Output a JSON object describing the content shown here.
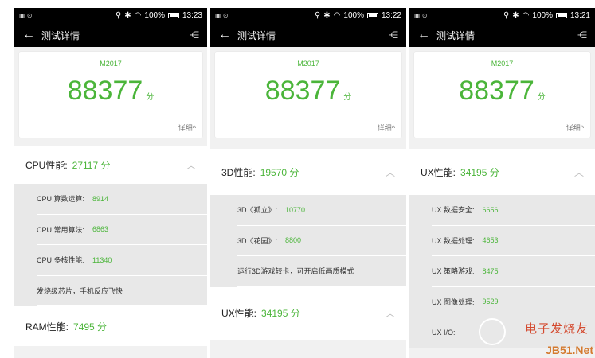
{
  "screens": [
    {
      "time": "13:23",
      "battery": "100%",
      "app_title": "测试详情",
      "model": "M2017",
      "score": "88377",
      "score_unit": "分",
      "detail_link": "详细^",
      "sections": [
        {
          "label": "CPU性能:",
          "value": "27117 分",
          "rows": [
            {
              "label": "CPU 算数运算:",
              "value": "8914"
            },
            {
              "label": "CPU 常用算法:",
              "value": "6863"
            },
            {
              "label": "CPU 多核性能:",
              "value": "11340"
            },
            {
              "label": "发烧级芯片，手机反应飞快",
              "value": ""
            }
          ]
        },
        {
          "label": "RAM性能:",
          "value": "7495 分",
          "rows": []
        }
      ]
    },
    {
      "time": "13:22",
      "battery": "100%",
      "app_title": "测试详情",
      "model": "M2017",
      "score": "88377",
      "score_unit": "分",
      "detail_link": "详细^",
      "sections": [
        {
          "label": "3D性能:",
          "value": "19570 分",
          "rows": [
            {
              "label": "3D《孤立》:",
              "value": "10770"
            },
            {
              "label": "3D《花园》:",
              "value": "8800"
            },
            {
              "label": "运行3D游戏较卡，可开启低画质模式",
              "value": ""
            }
          ]
        },
        {
          "label": "UX性能:",
          "value": "34195 分",
          "rows": []
        }
      ]
    },
    {
      "time": "13:21",
      "battery": "100%",
      "app_title": "测试详情",
      "model": "M2017",
      "score": "88377",
      "score_unit": "分",
      "detail_link": "详细^",
      "sections": [
        {
          "label": "UX性能:",
          "value": "34195 分",
          "rows": [
            {
              "label": "UX 数据安全:",
              "value": "6656"
            },
            {
              "label": "UX 数据处理:",
              "value": "4653"
            },
            {
              "label": "UX 策略游戏:",
              "value": "8475"
            },
            {
              "label": "UX 图像处理:",
              "value": "9529"
            },
            {
              "label": "UX I/O:",
              "value": ""
            }
          ]
        }
      ]
    }
  ],
  "watermark": {
    "cn": "电子发烧友",
    "en": "JB51.Net"
  },
  "colors": {
    "accent": "#4bb53a",
    "statusbar": "#000000",
    "row_bg": "#e8e8e8"
  }
}
